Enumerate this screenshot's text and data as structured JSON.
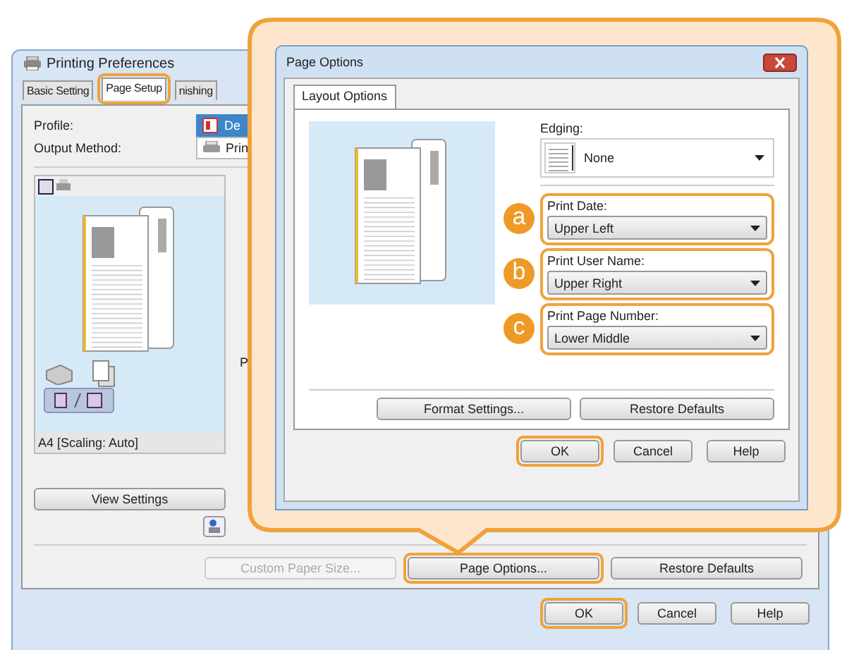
{
  "window": {
    "title": "Printing Preferences"
  },
  "tabs": [
    {
      "label": "Basic Setting",
      "selected": false,
      "highlighted": false
    },
    {
      "label": "Page Setup",
      "selected": true,
      "highlighted": true
    },
    {
      "label": "nishing",
      "selected": false,
      "highlighted": false
    }
  ],
  "fields": [
    {
      "label": "Profile:",
      "value": "De",
      "kind": "profile"
    },
    {
      "label": "Output Method:",
      "value": "Prin",
      "kind": "output"
    }
  ],
  "preview": {
    "caption": "A4 [Scaling: Auto]"
  },
  "view_settings_button": "View Settings",
  "partial_label": "P",
  "page_buttons": [
    {
      "label": "Custom Paper Size...",
      "disabled": true,
      "highlighted": false
    },
    {
      "label": "Page Options...",
      "disabled": false,
      "highlighted": true
    },
    {
      "label": "Restore Defaults",
      "disabled": false,
      "highlighted": false
    }
  ],
  "dialog_buttons": [
    {
      "label": "OK",
      "highlighted": true
    },
    {
      "label": "Cancel",
      "highlighted": false
    },
    {
      "label": "Help",
      "highlighted": false
    }
  ],
  "page_options": {
    "title": "Page Options",
    "tab": "Layout Options",
    "edging": {
      "label": "Edging:",
      "value": "None"
    },
    "options": [
      {
        "marker": "a",
        "label": "Print Date:",
        "value": "Upper Left",
        "highlighted": true
      },
      {
        "marker": "b",
        "label": "Print User Name:",
        "value": "Upper Right",
        "highlighted": true
      },
      {
        "marker": "c",
        "label": "Print Page Number:",
        "value": "Lower Middle",
        "highlighted": true
      }
    ],
    "buttons": [
      "Format Settings...",
      "Restore Defaults"
    ],
    "dialog_buttons": [
      {
        "label": "OK",
        "highlighted": true
      },
      {
        "label": "Cancel",
        "highlighted": false
      },
      {
        "label": "Help",
        "highlighted": false
      }
    ]
  }
}
